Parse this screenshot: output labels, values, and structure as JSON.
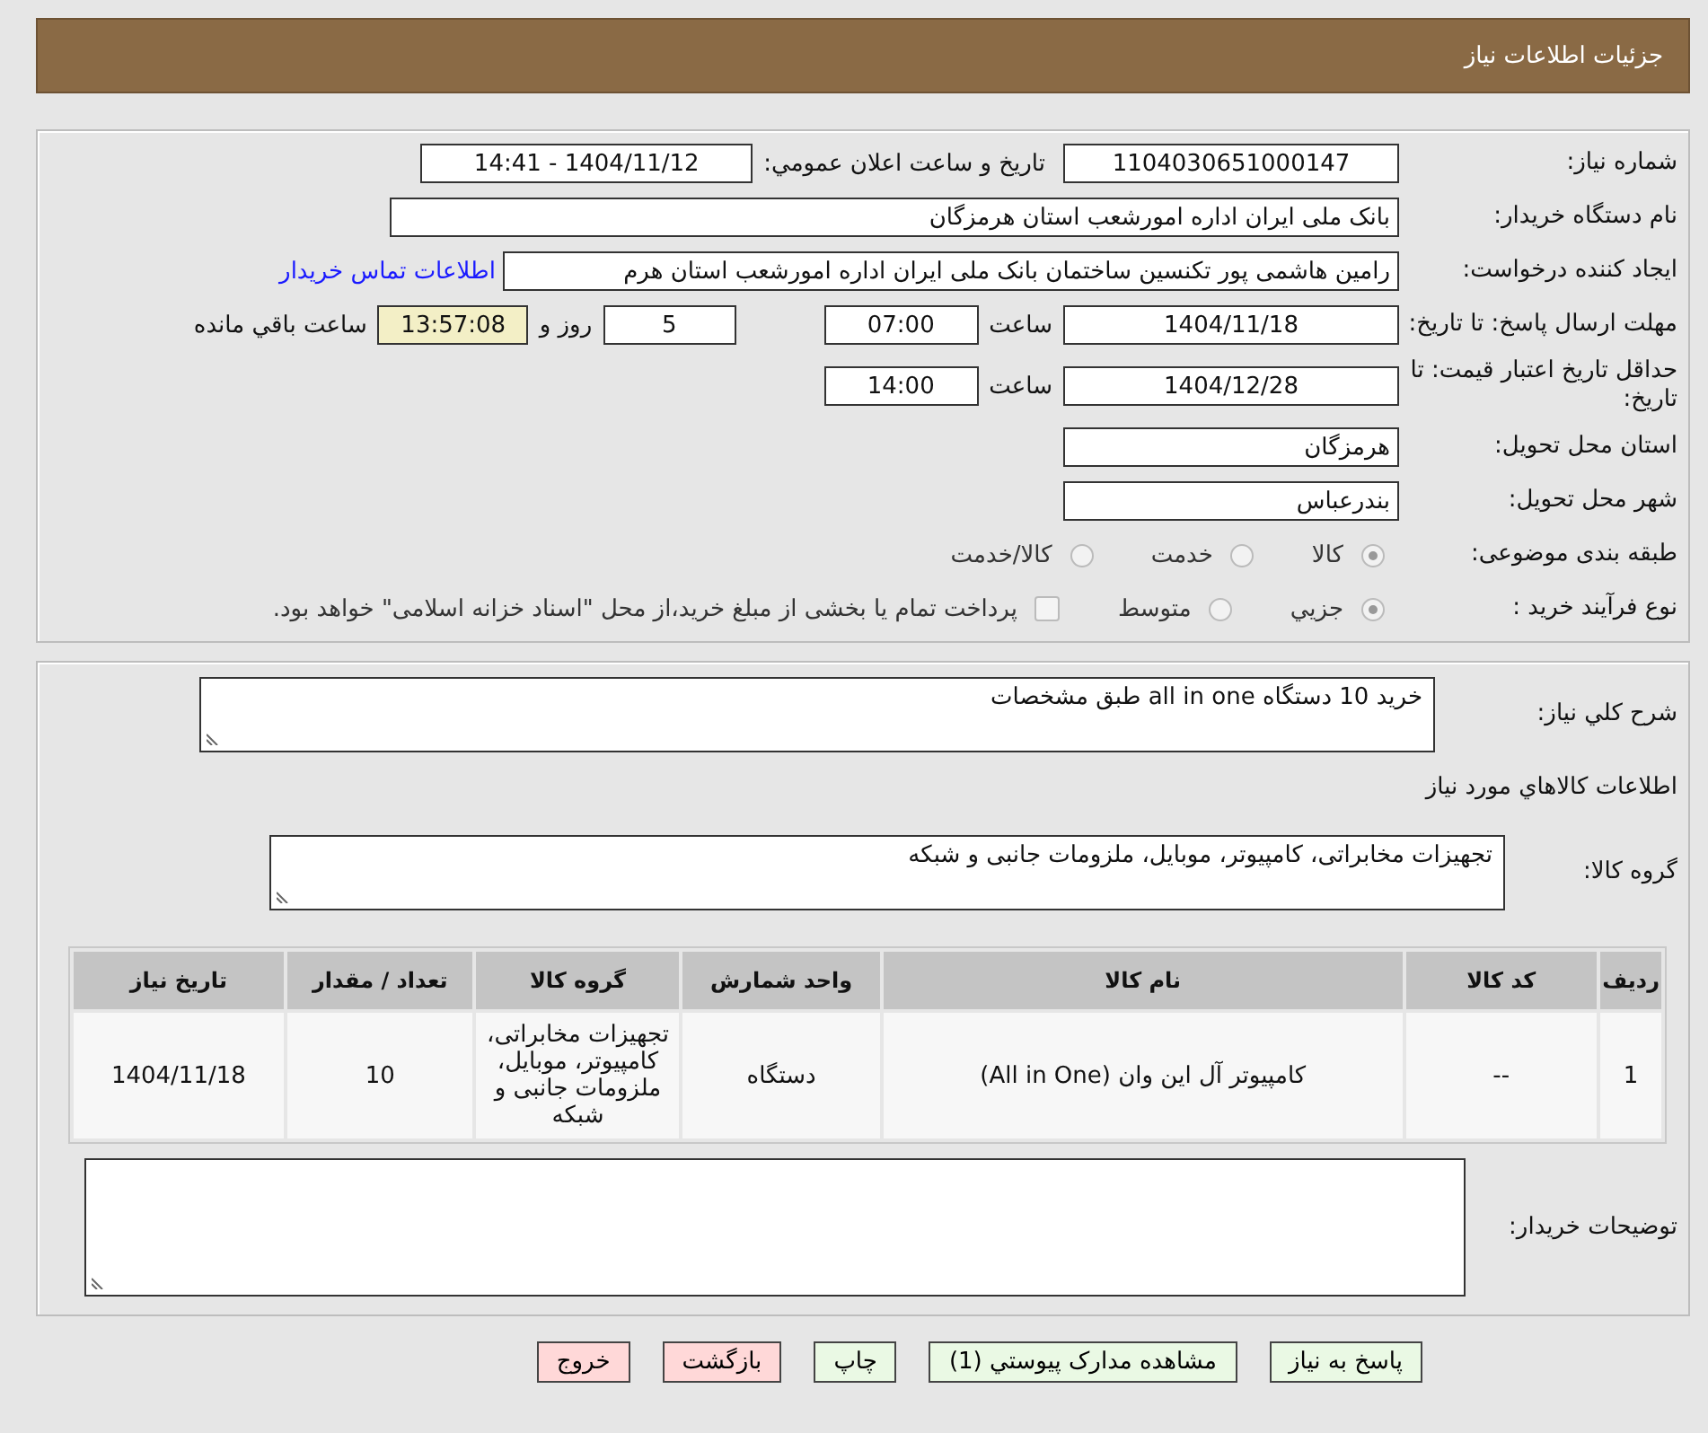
{
  "header": {
    "title": "جزئیات اطلاعات نیاز"
  },
  "info": {
    "need_number": {
      "label": "شماره نیاز:",
      "value": "1104030651000147"
    },
    "announce": {
      "label": "تاريخ و ساعت اعلان عمومي:",
      "value": "1404/11/12 - 14:41"
    },
    "buyer": {
      "label": "نام دستگاه خریدار:",
      "value": "بانک ملی ایران اداره امورشعب استان هرمزگان"
    },
    "requester": {
      "label": "ایجاد کننده درخواست:",
      "value": "رامین هاشمی پور تکنسین ساختمان بانک ملی ایران اداره امورشعب استان هرم",
      "link": "اطلاعات تماس خریدار"
    },
    "deadline": {
      "label": "مهلت ارسال پاسخ: تا تاریخ:",
      "date": "1404/11/18",
      "time_label": "ساعت",
      "time": "07:00",
      "days": "5",
      "days_label": "روز و",
      "remaining": "13:57:08",
      "remaining_label": "ساعت باقي مانده"
    },
    "validity": {
      "label": "حداقل تاریخ اعتبار قیمت: تا تاریخ:",
      "date": "1404/12/28",
      "time_label": "ساعت",
      "time": "14:00"
    },
    "province": {
      "label": "استان محل تحویل:",
      "value": "هرمزگان"
    },
    "city": {
      "label": "شهر محل تحویل:",
      "value": "بندرعباس"
    },
    "category": {
      "label": "طبقه بندی موضوعی:",
      "options": [
        {
          "label": "کالا",
          "selected": true
        },
        {
          "label": "خدمت",
          "selected": false
        },
        {
          "label": "کالا/خدمت",
          "selected": false
        }
      ]
    },
    "process": {
      "label": "نوع فرآیند خرید :",
      "options": [
        {
          "label": "جزيي",
          "selected": true
        },
        {
          "label": "متوسط",
          "selected": false
        }
      ],
      "checkbox": {
        "label": "پرداخت تمام یا بخشی از مبلغ خرید،از محل \"اسناد خزانه اسلامی\" خواهد بود.",
        "checked": false
      }
    }
  },
  "summary": {
    "label": "شرح کلي نیاز:",
    "value": "خرید 10 دستگاه all in one طبق مشخصات"
  },
  "goods_title": "اطلاعات کالاهاي مورد نیاز",
  "group": {
    "label": "گروه کالا:",
    "value": "تجهیزات مخابراتی، کامپیوتر، موبایل، ملزومات جانبی و شبکه"
  },
  "table": {
    "columns": [
      "ردیف",
      "کد کالا",
      "نام کالا",
      "واحد شمارش",
      "گروه کالا",
      "تعداد / مقدار",
      "تاریخ نیاز"
    ],
    "rows": [
      [
        "1",
        "--",
        "کامپیوتر آل این وان (All in One)",
        "دستگاه",
        "تجهیزات مخابراتی، کامپیوتر، موبایل، ملزومات جانبی و شبکه",
        "10",
        "1404/11/18"
      ]
    ]
  },
  "notes": {
    "label": "توضیحات خریدار:"
  },
  "buttons": [
    {
      "label": "پاسخ به نیاز",
      "kind": "go"
    },
    {
      "label": "مشاهده مدارک پیوستي (1)",
      "kind": "go"
    },
    {
      "label": "چاپ",
      "kind": "go"
    },
    {
      "label": "بازگشت",
      "kind": "stop"
    },
    {
      "label": "خروج",
      "kind": "stop"
    }
  ]
}
